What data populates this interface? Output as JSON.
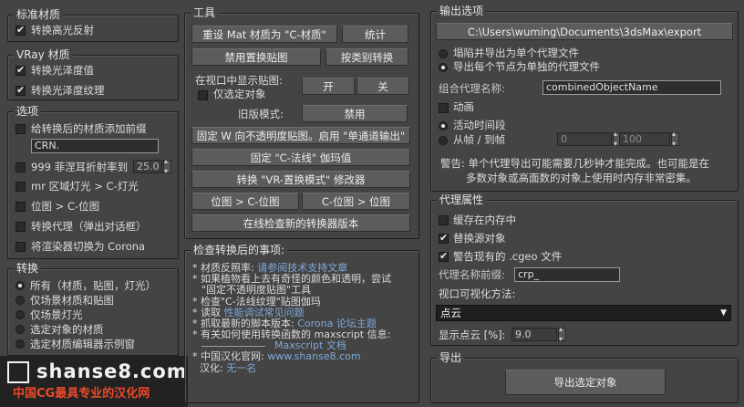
{
  "std_mat": {
    "title": "标准材质",
    "spec": "转换高光反射"
  },
  "vray_mat": {
    "title": "VRay 材质",
    "gloss": "转换光泽度值",
    "gloss_tex": "转换光泽度纹理"
  },
  "options": {
    "title": "选项",
    "prefix": "给转换后的材质添加前缀",
    "prefix_value": "CRN.",
    "fresnel": "999 菲涅耳折射率到",
    "fresnel_value": "25.0",
    "mr_area": "mr 区域灯光 > C-灯光",
    "bitmap": "位图 > C-位图",
    "proxy": "转换代理（弹出对话框）",
    "renderer": "将渲染器切换为 Corona"
  },
  "convert": {
    "title": "转换",
    "all": "所有（材质，贴图，灯光）",
    "scene_mats": "仅场景材质和贴图",
    "scene_lights": "仅场景灯光",
    "selected": "选定对象的材质",
    "editor": "选定材质编辑器示例窗"
  },
  "tools": {
    "title": "工具",
    "reset_mat": "重设 Mat 材质为 \"C-材质\"",
    "stats": "统计",
    "disable_disp": "禁用置换贴图",
    "by_type": "按类别转换",
    "show_maps": "在视口中显示贴图:",
    "sel_only": "仅选定对象",
    "on": "开",
    "off": "关",
    "legacy_label": "旧版模式:",
    "disable": "禁用",
    "fix_opacity": "固定 W 向不透明度贴图。启用 \"单通道输出\"",
    "fix_normal": "固定 \"C-法线\" 伽玛值",
    "vr_disp": "转换 \"VR-置换模式\" 修改器",
    "bm_to_c": "位图 > C-位图",
    "c_to_bm": "C-位图 > 位图",
    "check_update": "在线检查新的转换器版本"
  },
  "check": {
    "title": "检查转换后的事项:",
    "l1a": "* 材质反照率:",
    "l1b": "请参阅技术支持文章",
    "l2": "* 如果植物看上去有奇怪的颜色和透明，尝试",
    "l3": "\"固定不透明度贴图\"工具",
    "l4": "* 检查\"C-法线纹理\"贴图伽玛",
    "l5a": "* 读取",
    "l5b": "性能调试常见问题",
    "l6a": "* 抓取最新的脚本版本:",
    "l6b": "Corona 论坛主题",
    "l7": "* 有关如何使用转换函数的 maxscript 信息:",
    "l8": "Maxscript 文档",
    "l9a": "* 中国汉化官网:",
    "l9b": "www.shanse8.com",
    "l10a": "汉化:",
    "l10b": "无一名"
  },
  "export": {
    "title": "输出选项",
    "path": "C:\\Users\\wuming\\Documents\\3dsMax\\export",
    "merge": "塌陷并导出为单个代理文件",
    "each": "导出每个节点为单独的代理文件",
    "name_label": "组合代理名称:",
    "name_value": "combinedObjectName",
    "anim": "动画",
    "active": "活动时间段",
    "from_to": "从帧 / 到帧",
    "from_value": "0",
    "to_value": "100",
    "warning1": "警告: 单个代理导出可能需要几秒钟才能完成。也可能是在",
    "warning2": "多数对象或高面数的对象上使用时内存非常密集。"
  },
  "proxy": {
    "title": "代理属性",
    "cache": "缓存在内存中",
    "replace": "替换源对象",
    "warn_cgeo": "警告现有的 .cgeo 文件",
    "prefix_label": "代理名称前缀:",
    "prefix_value": "crp_",
    "viz_label": "视口可视化方法:",
    "viz_value": "点云",
    "pct_label": "显示点云 [%]:",
    "pct_value": "9.0"
  },
  "export_sel": {
    "title": "导出",
    "button": "导出选定对象"
  },
  "logo": {
    "brand": "shanse8.com",
    "slogan": "中国CG最具专业的汉化网"
  },
  "colors": {
    "bg": "#444444",
    "link": "#7fa8d8"
  }
}
